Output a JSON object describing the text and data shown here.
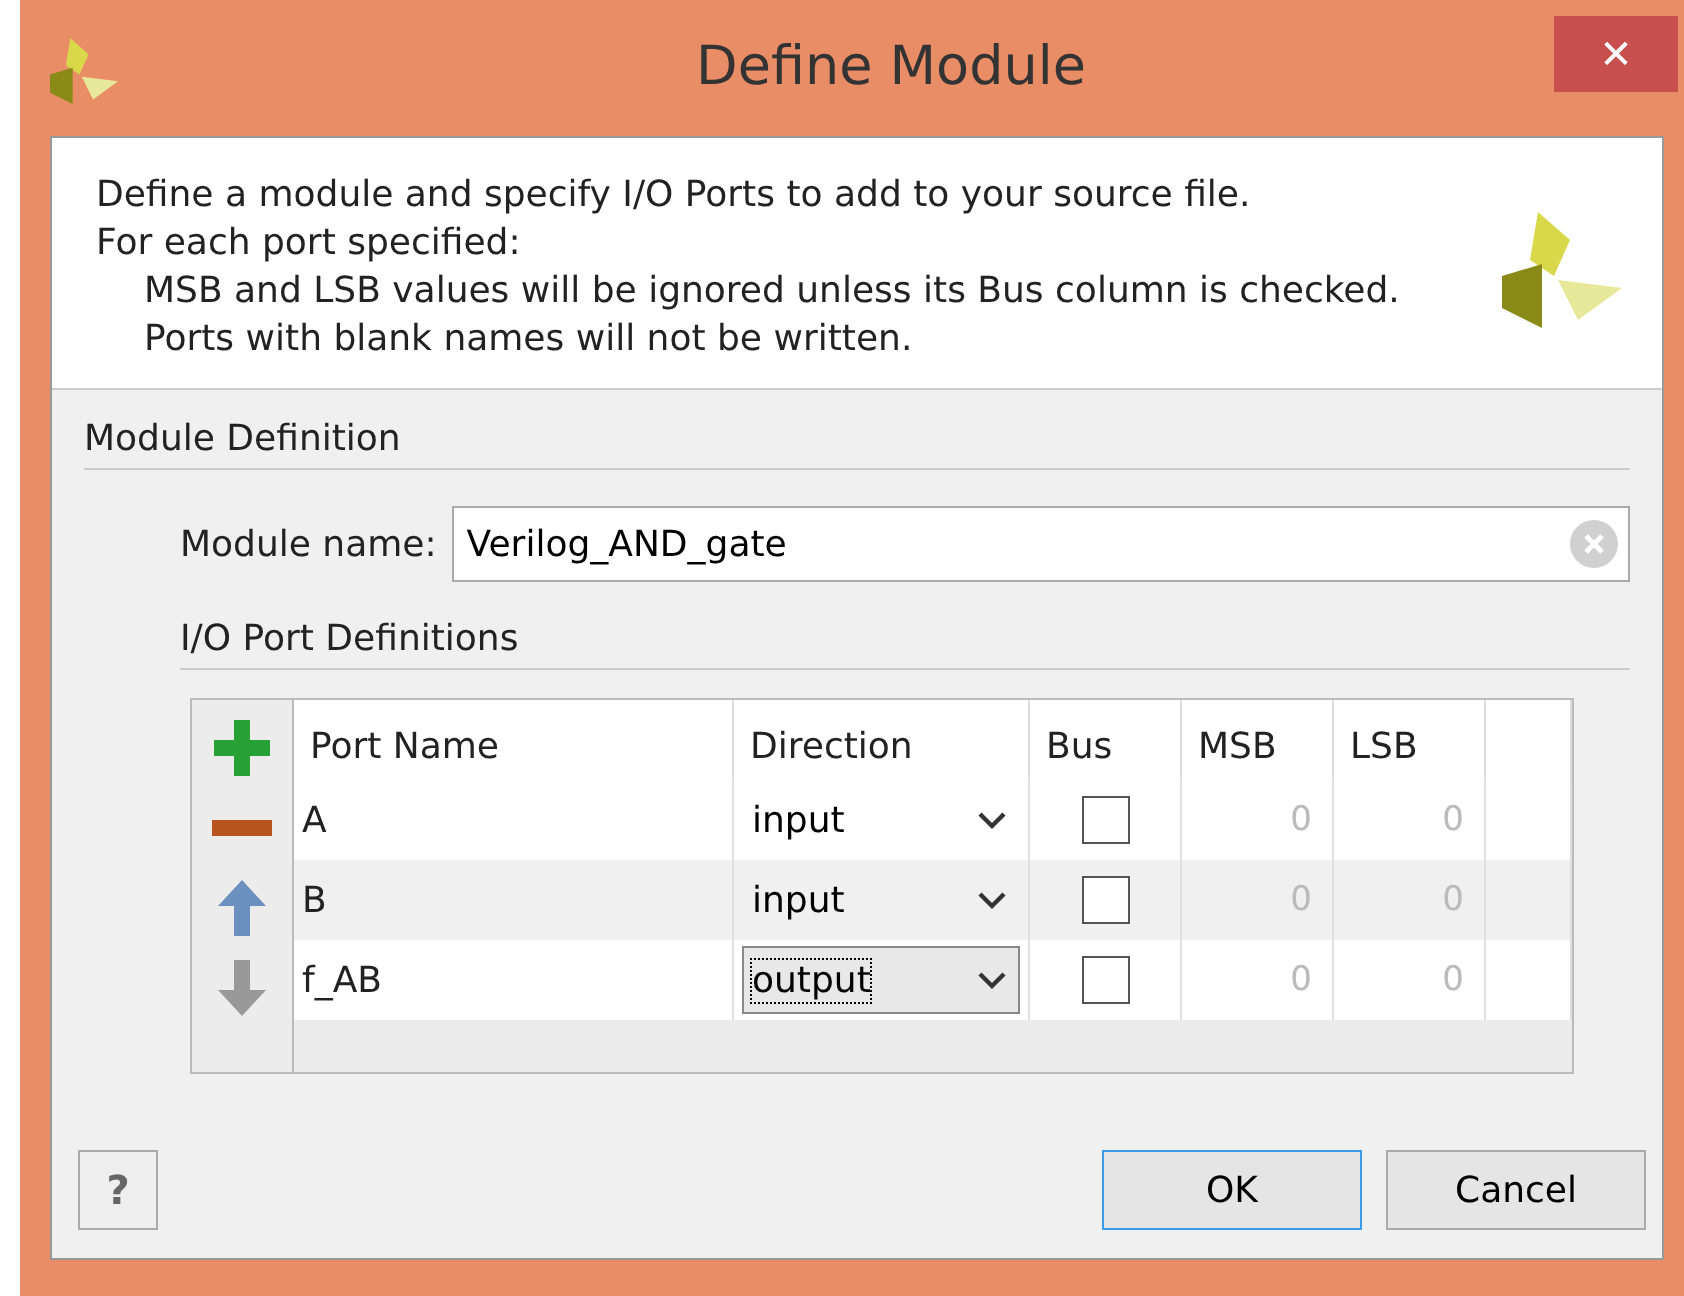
{
  "window": {
    "title": "Define Module",
    "close": "✕"
  },
  "intro": [
    {
      "text": "Define a module and specify I/O Ports to add to your source file.",
      "indented": false
    },
    {
      "text": "For each port specified:",
      "indented": false
    },
    {
      "text": "MSB and LSB values will be ignored unless its Bus column is checked.",
      "indented": true
    },
    {
      "text": "Ports with blank names will not be written.",
      "indented": true
    }
  ],
  "section": "Module Definition",
  "module_name": {
    "label": "Module name:",
    "value": "Verilog_AND_gate"
  },
  "ports_title": "I/O Port Definitions",
  "tools": [
    {
      "kind": "add",
      "disabled": false
    },
    {
      "kind": "remove",
      "disabled": false
    },
    {
      "kind": "up",
      "disabled": false
    },
    {
      "kind": "down",
      "disabled": true
    }
  ],
  "table": {
    "columns": [
      "Port Name",
      "Direction",
      "Bus",
      "MSB",
      "LSB"
    ],
    "rows": [
      {
        "name": "A",
        "direction": "input",
        "bus": false,
        "msb": "0",
        "lsb": "0",
        "focused": false
      },
      {
        "name": "B",
        "direction": "input",
        "bus": false,
        "msb": "0",
        "lsb": "0",
        "focused": false
      },
      {
        "name": "f_AB",
        "direction": "output",
        "bus": false,
        "msb": "0",
        "lsb": "0",
        "focused": true
      }
    ]
  },
  "help": "?",
  "buttons": [
    {
      "label": "OK",
      "default": true
    },
    {
      "label": "Cancel",
      "default": false
    }
  ]
}
